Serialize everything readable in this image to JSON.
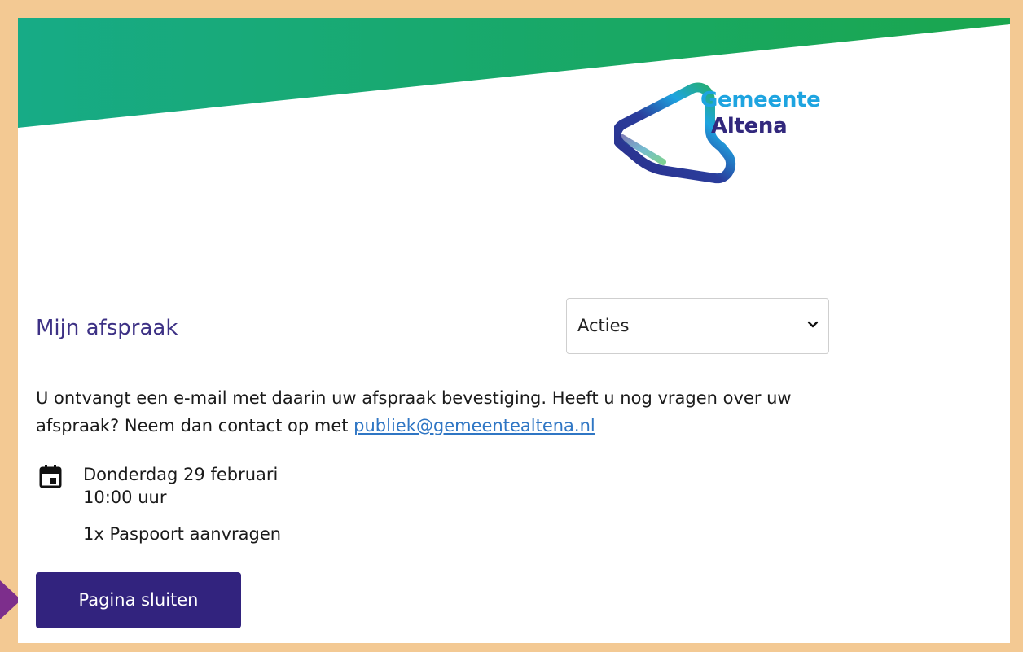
{
  "logo": {
    "line1": "Gemeente",
    "line2": "Altena"
  },
  "page": {
    "title": "Mijn afspraak"
  },
  "actions": {
    "selected": "Acties"
  },
  "intro": {
    "text_before_link": "U ontvangt een e-mail met daarin uw afspraak bevestiging. Heeft u nog vragen over uw afspraak? Neem dan contact op met ",
    "email": "publiek@gemeentealtena.nl"
  },
  "appointment": {
    "date": "Donderdag 29 februari",
    "time": "10:00 uur",
    "service": "1x Paspoort aanvragen",
    "icon": "calendar-icon"
  },
  "buttons": {
    "close_label": "Pagina sluiten"
  },
  "colors": {
    "frame": "#f3c993",
    "brand_purple": "#32237e",
    "title_purple": "#3d3185",
    "banner_start": "#1aa884",
    "banner_end": "#1aa652",
    "logo_blue": "#1ea4e0",
    "link_blue": "#2f76c4"
  }
}
